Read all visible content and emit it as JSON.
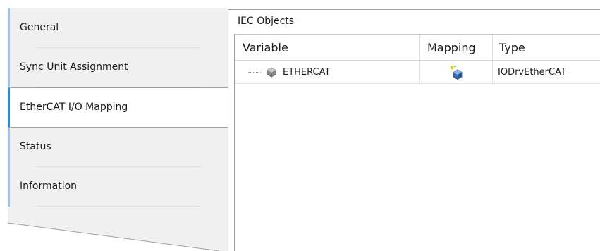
{
  "tabs": [
    {
      "label": "General",
      "active": false
    },
    {
      "label": "Sync Unit Assignment",
      "active": false
    },
    {
      "label": "EtherCAT I/O Mapping",
      "active": true
    },
    {
      "label": "Status",
      "active": false
    },
    {
      "label": "Information",
      "active": false
    }
  ],
  "panel": {
    "title": "IEC Objects",
    "columns": {
      "variable": "Variable",
      "mapping": "Mapping",
      "type": "Type"
    },
    "rows": [
      {
        "variable": "ETHERCAT",
        "mapping_icon": "new-mapping-icon",
        "type": "IODrvEtherCAT"
      }
    ]
  },
  "colors": {
    "tab_bg": "#f0f0f0",
    "tab_accent": "#9fc3e7",
    "tab_active_accent": "#2a8ad4",
    "border": "#a0a0a0"
  }
}
